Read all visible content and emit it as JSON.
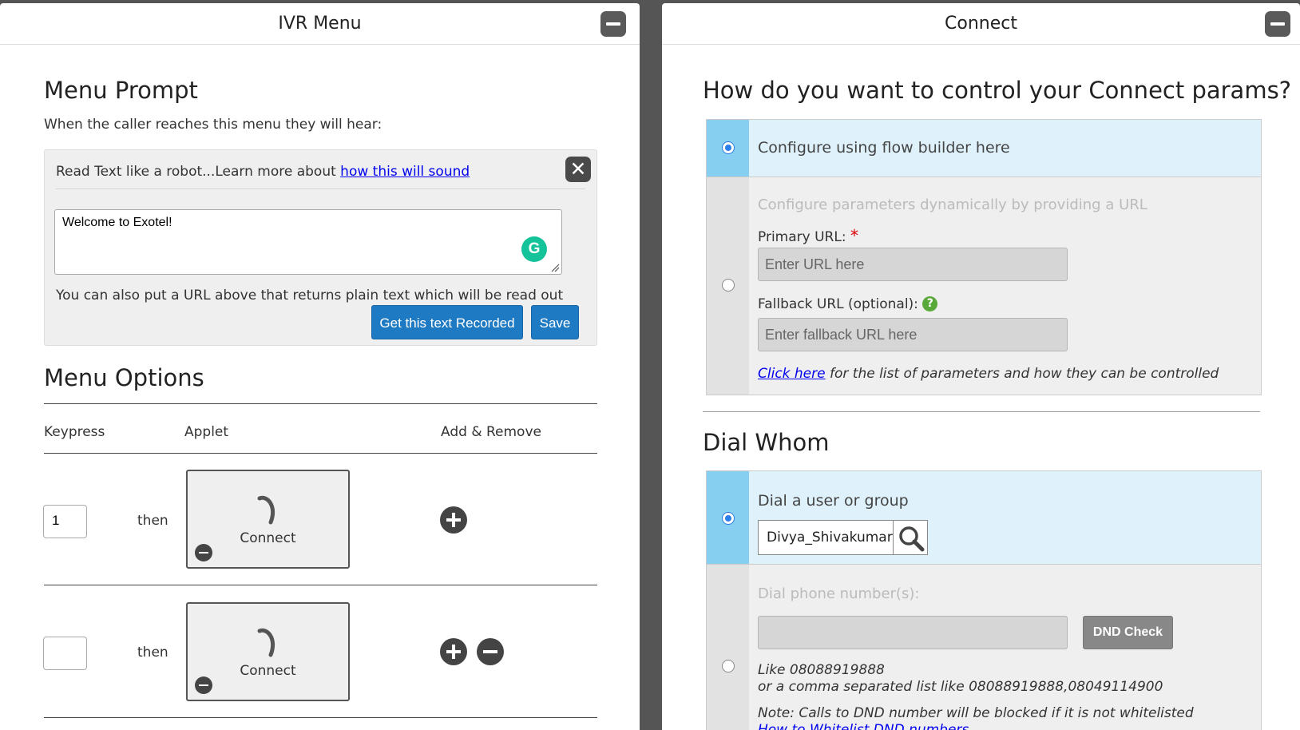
{
  "left_panel": {
    "title": "IVR Menu",
    "menu_prompt": {
      "heading": "Menu Prompt",
      "subtext": "When the caller reaches this menu they will hear:",
      "read_text_prefix": "Read Text like a robot...Learn more about ",
      "read_text_link": "how this will sound",
      "textarea_value": "Welcome to Exotel!",
      "url_note": "You can also put a URL above that returns plain text which will be read out",
      "record_button": "Get this text Recorded",
      "save_button": "Save"
    },
    "menu_options": {
      "heading": "Menu Options",
      "columns": [
        "Keypress",
        "Applet",
        "Add & Remove"
      ],
      "rows": [
        {
          "keypress": "1",
          "then": "then",
          "applet": "Connect"
        },
        {
          "keypress": "",
          "then": "then",
          "applet": "Connect"
        }
      ]
    }
  },
  "right_panel": {
    "title": "Connect",
    "params": {
      "heading": "How do you want to control your Connect params?",
      "option_flow": "Configure using flow builder here",
      "option_dynamic": "Configure parameters dynamically by providing a URL",
      "primary_url_label": "Primary URL:",
      "required_mark": "*",
      "primary_url_placeholder": "Enter URL here",
      "fallback_url_label": "Fallback URL (optional):",
      "help_icon": "?",
      "fallback_url_placeholder": "Enter fallback URL here",
      "click_here_link": "Click here",
      "click_here_rest": " for the list of parameters and how they can be controlled"
    },
    "dial_whom": {
      "heading": "Dial Whom",
      "option_user": "Dial a user or group",
      "user_value": "Divya_Shivakumar",
      "option_phone": "Dial phone number(s):",
      "dnd_button": "DND Check",
      "hint_line1": "Like 08088919888",
      "hint_line2": "or a comma separated list like 08088919888,08049114900",
      "dnd_note": "Note: Calls to DND number will be blocked if it is not whitelisted",
      "whitelist_link": "How to Whitelist DND numbers"
    }
  },
  "colors": {
    "accent_blue": "#1f7ac4",
    "selected_row": "#dff2fb",
    "selected_radio_col": "#87cff0",
    "grammarly": "#15c39a"
  }
}
